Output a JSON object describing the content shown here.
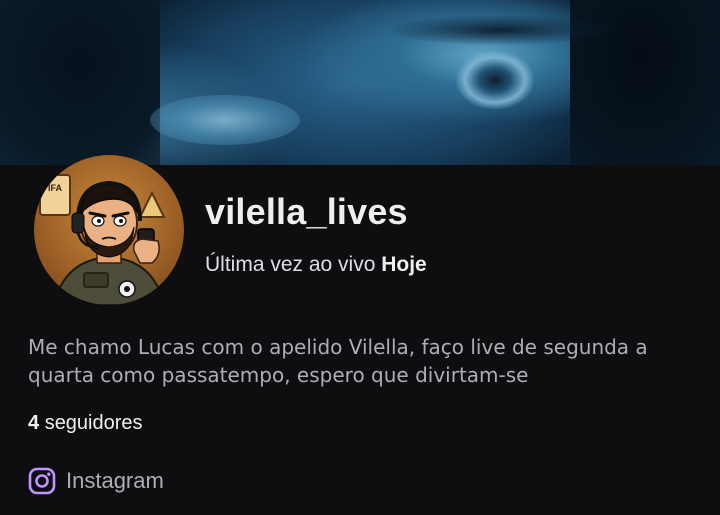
{
  "profile": {
    "username": "vilella_lives",
    "last_live_label": "Última vez ao vivo",
    "last_live_value": "Hoje",
    "bio": "Me chamo Lucas com o apelido Vilella, faço live de segunda a quarta como passatempo, espero que divirtam-se",
    "followers_count": "4",
    "followers_label": "seguidores"
  },
  "avatar": {
    "icon": "cartoon-avatar",
    "sign_text": "IFA"
  },
  "social": {
    "label": "Instagram",
    "icon": "instagram-icon",
    "accent": "#bf94ff"
  },
  "colors": {
    "background": "#0e0e10",
    "text_primary": "#efeff1",
    "text_secondary": "#adadb8"
  }
}
